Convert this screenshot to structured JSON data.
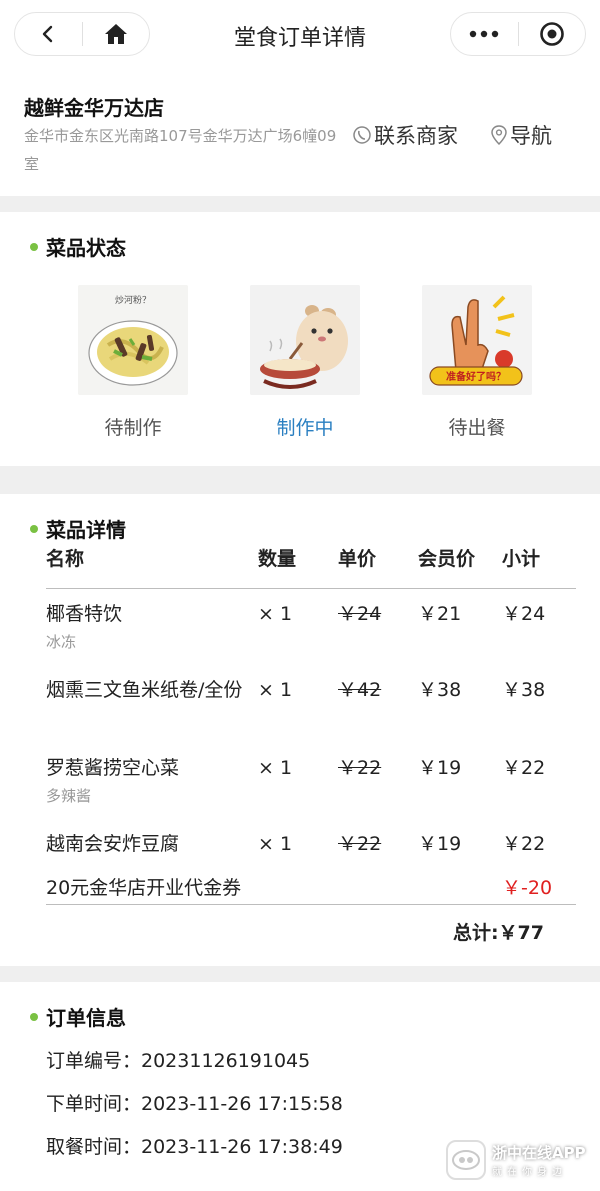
{
  "topbar": {
    "title": "堂食订单详情",
    "back_icon": "chevron-left-icon",
    "home_icon": "home-icon",
    "more_icon": "more-dots-icon",
    "close_icon": "target-circle-icon"
  },
  "store": {
    "name": "越鲜金华万达店",
    "address": "金华市金东区光南路107号金华万达广场6幢09室",
    "contact_label": "联系商家",
    "nav_label": "导航"
  },
  "status": {
    "title": "菜品状态",
    "steps": [
      {
        "label": "待制作",
        "image_caption": "炒河粉？",
        "state": "done"
      },
      {
        "label": "制作中",
        "image_caption": "",
        "state": "active"
      },
      {
        "label": "待出餐",
        "image_caption": "准备好了吗？",
        "state": "pending"
      }
    ],
    "active_color": "#2a7fc1"
  },
  "dishes": {
    "title": "菜品详情",
    "headers": {
      "name": "名称",
      "qty": "数量",
      "price": "单价",
      "member_price": "会员价",
      "subtotal": "小计"
    },
    "items": [
      {
        "name": "椰香特饮",
        "note": "冰冻",
        "qty": "× 1",
        "price": "￥24",
        "member_price": "￥21",
        "subtotal": "￥24"
      },
      {
        "name": "烟熏三文鱼米纸卷/全份",
        "note": "",
        "qty": "× 1",
        "price": "￥42",
        "member_price": "￥38",
        "subtotal": "￥38"
      },
      {
        "name": "罗惹酱捞空心菜",
        "note": "多辣酱",
        "qty": "× 1",
        "price": "￥22",
        "member_price": "￥19",
        "subtotal": "￥22"
      },
      {
        "name": "越南会安炸豆腐",
        "note": "",
        "qty": "× 1",
        "price": "￥22",
        "member_price": "￥19",
        "subtotal": "￥22"
      }
    ],
    "voucher": {
      "name": "20元金华店开业代金券",
      "amount": "￥-20"
    },
    "total": "总计:￥77",
    "discount_color": "#e02020"
  },
  "order": {
    "title": "订单信息",
    "lines": [
      "订单编号：20231126191045",
      "下单时间：2023-11-26 17:15:58",
      "取餐时间：2023-11-26 17:38:49"
    ]
  },
  "watermark": {
    "title": "浙中在线APP",
    "subtitle": "就在你身边"
  },
  "accent_color": "#7ac143"
}
